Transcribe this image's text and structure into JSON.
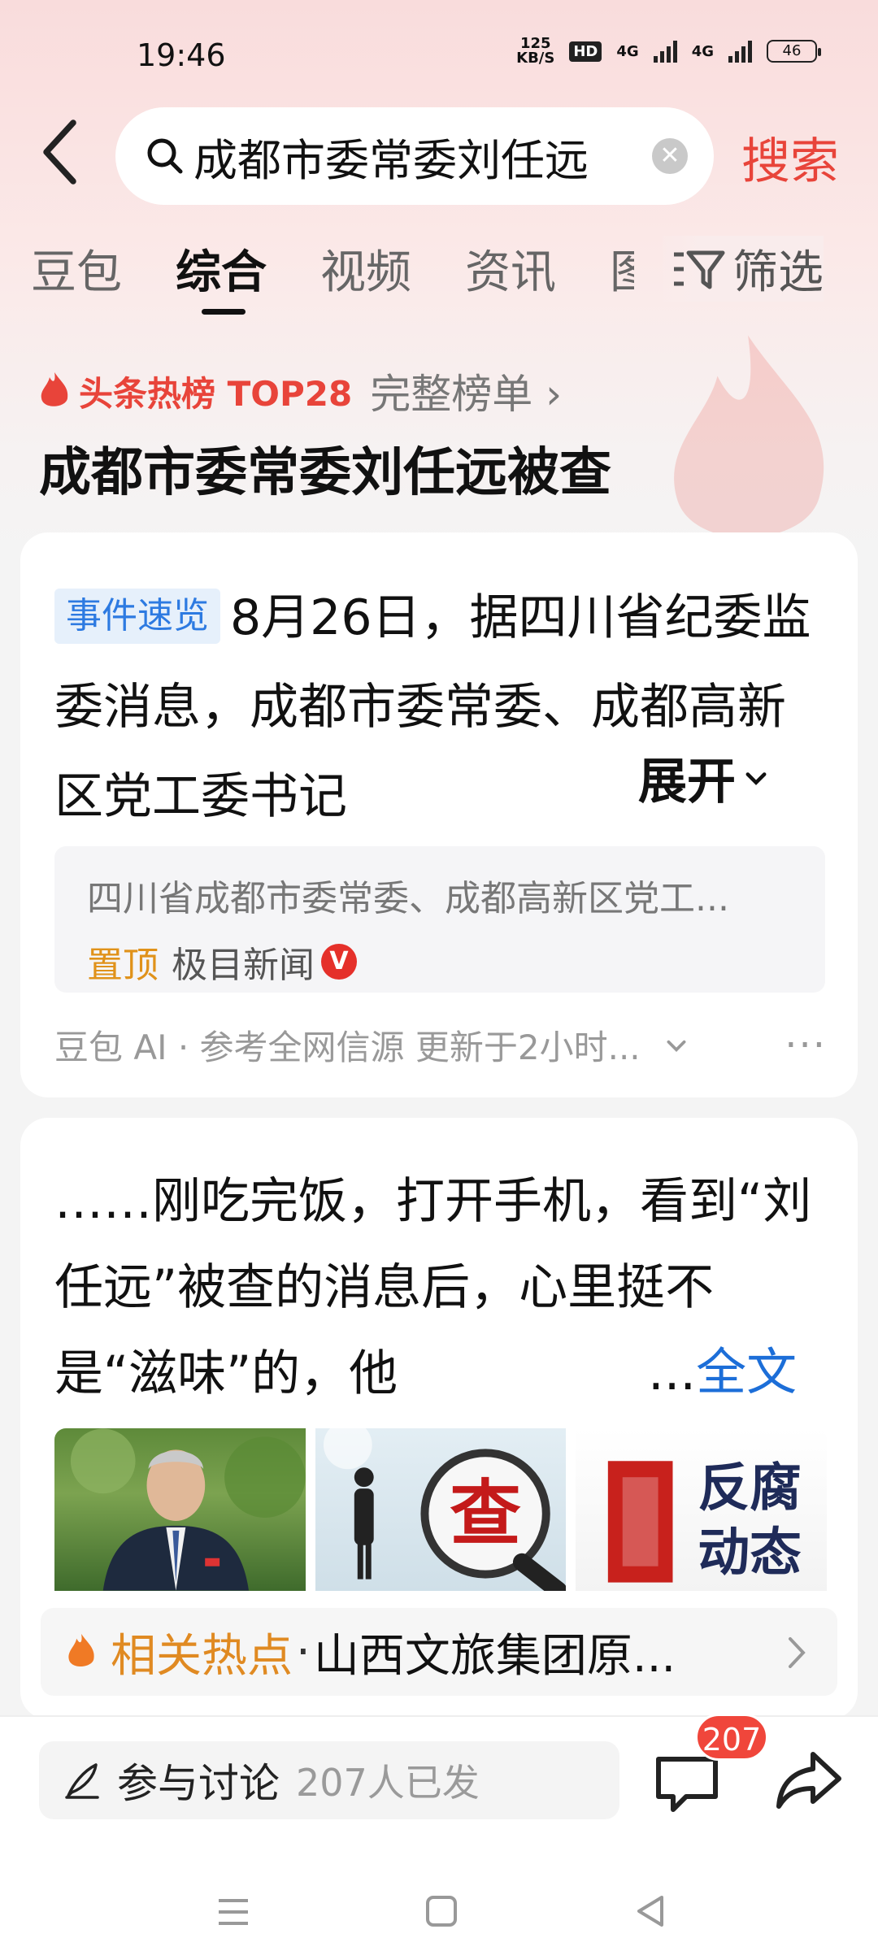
{
  "status_bar": {
    "time": "19:46",
    "net_speed_value": "125",
    "net_speed_unit": "KB/S",
    "hd_label": "HD",
    "net1": "4G",
    "net2": "4G",
    "battery": "46"
  },
  "search": {
    "query": "成都市委常委刘任远",
    "button_label": "搜索"
  },
  "tabs": [
    "豆包",
    "综合",
    "视频",
    "资讯",
    "图"
  ],
  "active_tab": "综合",
  "filter_label": "筛选",
  "hot": {
    "label": "头条热榜 TOP28",
    "more_label": "完整榜单 ›",
    "title": "成都市委常委刘任远被查"
  },
  "event_card": {
    "tag": "事件速览",
    "summary": "8月26日，据四川省纪委监委消息，成都市委常委、成都高新区党工委书记",
    "expand_label": "展开",
    "source_text": "四川省成都市委常委、成都高新区党工...",
    "pin_label": "置顶",
    "media_name": "极目新闻",
    "verified_badge": "V",
    "ai_note": "豆包 AI · 参考全网信源 更新于2小时...",
    "more_label": "···"
  },
  "post_card": {
    "text": "……刚吃完饭，打开手机，看到“刘任远”被查的消息后，心里挺不是“滋味”的，他",
    "ellipsis": "...",
    "fulltext_label": "全文",
    "image2_char": "查",
    "image3_line1": "反腐",
    "image3_line2": "动态"
  },
  "related": {
    "label": "相关热点",
    "separator": "·",
    "text": "山西文旅集团原..."
  },
  "bottom": {
    "discuss_label": "参与讨论",
    "discuss_count": "207人已发",
    "comment_badge": "207"
  },
  "colors": {
    "accent_red": "#e8443a",
    "link_blue": "#1c6ed8",
    "hot_orange": "#e08a22"
  }
}
